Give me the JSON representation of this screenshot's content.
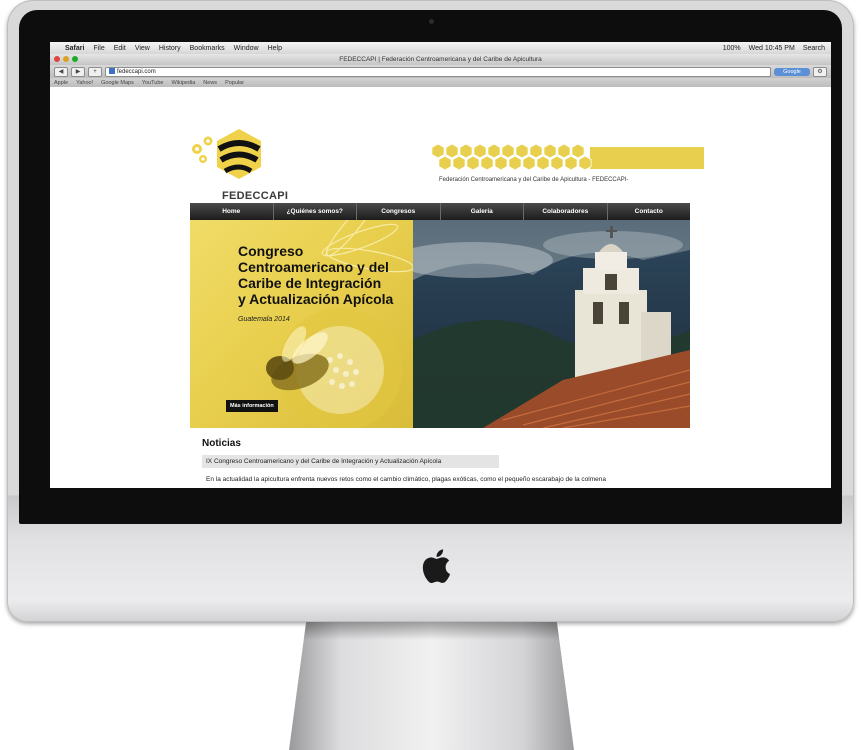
{
  "os_menubar": {
    "apple": "",
    "items": [
      "Safari",
      "File",
      "Edit",
      "View",
      "History",
      "Bookmarks",
      "Window",
      "Help"
    ],
    "right": [
      "100%",
      "Wed 10:45 PM",
      "Search"
    ]
  },
  "browser": {
    "window_title": "FEDECCAPI | Federación Centroamericana y del Caribe de Apicultura",
    "url": "fedeccapi.com",
    "search_label": "Google",
    "bookmarks": [
      "Apple",
      "Yahoo!",
      "Google Maps",
      "YouTube",
      "Wikipedia",
      "News",
      "Popular"
    ]
  },
  "site": {
    "logo_text": "FEDECCAPI",
    "tagline": "Federación Centroamericana y del Caribe de Apicultura - FEDECCAPI-",
    "nav": [
      "Home",
      "¿Quiénes somos?",
      "Congresos",
      "Galería",
      "Colaboradores",
      "Contacto"
    ],
    "banner": {
      "title_lines": [
        "Congreso",
        "Centroamericano y del",
        "Caribe de Integración",
        "y Actualización Apícola"
      ],
      "subtitle": "Guatemala 2014",
      "button": "Más información"
    },
    "news": {
      "heading": "Noticias",
      "item_title": "IX Congreso Centroamericano y del Caribe de Integración y Actualización Apícola",
      "item_text": "En la actualidad la apicultura enfrenta nuevos retos como el cambio climático, plagas exóticas, como el pequeño escarabajo de la colmena"
    }
  },
  "colors": {
    "brand_yellow": "#e8cf4d",
    "nav_dark": "#2a2a2a"
  }
}
